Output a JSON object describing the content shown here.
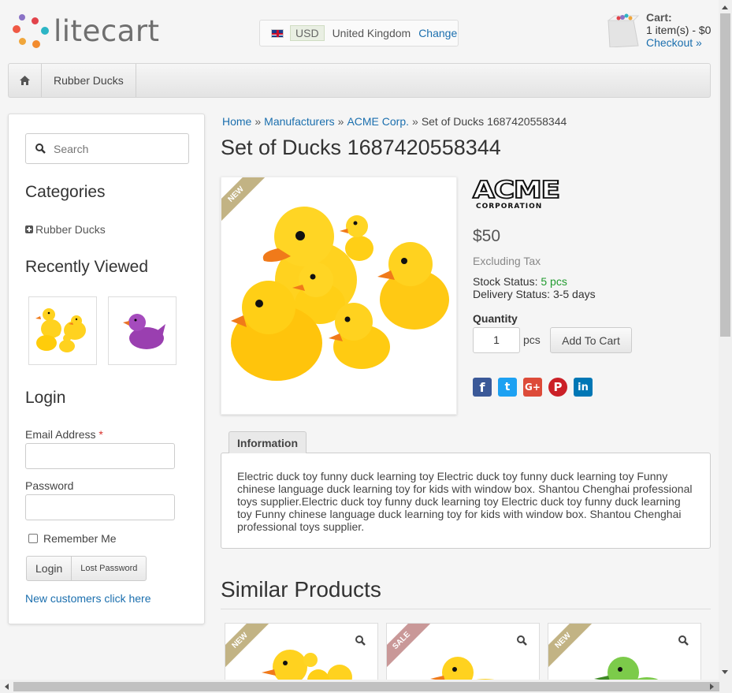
{
  "header": {
    "logo_text": "litecart",
    "region": {
      "currency": "USD",
      "country": "United Kingdom",
      "change_label": "Change"
    },
    "cart": {
      "title": "Cart:",
      "summary": "1 item(s) - $0",
      "checkout_label": "Checkout »"
    }
  },
  "navbar": {
    "items": [
      {
        "label": "Rubber Ducks"
      }
    ]
  },
  "sidebar": {
    "search": {
      "placeholder": "Search"
    },
    "categories": {
      "title": "Categories",
      "items": [
        {
          "label": "Rubber Ducks"
        }
      ]
    },
    "recently_viewed": {
      "title": "Recently Viewed"
    },
    "login": {
      "title": "Login",
      "email_label": "Email Address",
      "required_mark": "*",
      "password_label": "Password",
      "remember_label": "Remember Me",
      "login_button": "Login",
      "lost_password_button": "Lost Password",
      "new_customers_link": "New customers click here"
    }
  },
  "breadcrumb": {
    "items": [
      {
        "label": "Home"
      },
      {
        "label": "Manufacturers"
      },
      {
        "label": "ACME Corp."
      },
      {
        "label": "Set of Ducks 1687420558344"
      }
    ],
    "separator": "»"
  },
  "product": {
    "title": "Set of Ducks 1687420558344",
    "badge": "NEW",
    "manufacturer_logo": {
      "line1": "ACME",
      "line2": "CORPORATION"
    },
    "price": "$50",
    "tax_note": "Excluding Tax",
    "stock_label": "Stock Status:",
    "stock_value": "5 pcs",
    "delivery_label": "Delivery Status:",
    "delivery_value": "3-5 days",
    "quantity_label": "Quantity",
    "quantity_value": "1",
    "quantity_unit": "pcs",
    "add_to_cart": "Add To Cart",
    "social": {
      "facebook": "f",
      "twitter": "t",
      "googleplus": "G+",
      "pinterest": "P",
      "linkedin": "in"
    }
  },
  "tabs": {
    "information_label": "Information",
    "description": "Electric duck toy funny duck learning toy Electric duck toy funny duck learning toy Funny chinese language duck learning toy for kids with window box. Shantou Chenghai professional toys supplier.Electric duck toy funny duck learning toy Electric duck toy funny duck learning toy Funny chinese language duck learning toy for kids with window box. Shantou Chenghai professional toys supplier."
  },
  "similar": {
    "title": "Similar Products",
    "cards": [
      {
        "badge": "NEW"
      },
      {
        "badge": "SALE"
      },
      {
        "badge": "NEW"
      }
    ]
  },
  "colors": {
    "accent": "#1b6fae",
    "in_stock": "#219b2f",
    "new_badge": "#c2b384",
    "sale_badge": "#c99898"
  }
}
